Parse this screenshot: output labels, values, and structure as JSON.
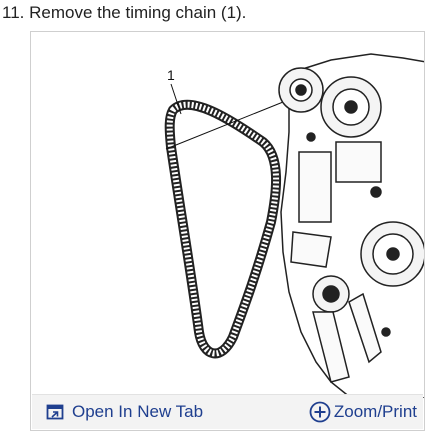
{
  "step": {
    "text": "11. Remove the timing chain (1)."
  },
  "figure": {
    "callout_label": "1"
  },
  "toolbar": {
    "open_label": "Open In New Tab",
    "zoom_label": "Zoom/Print",
    "open_icon": "open-in-new-tab-icon",
    "zoom_icon": "zoom-plus-icon",
    "accent_color": "#1f3f8f"
  }
}
